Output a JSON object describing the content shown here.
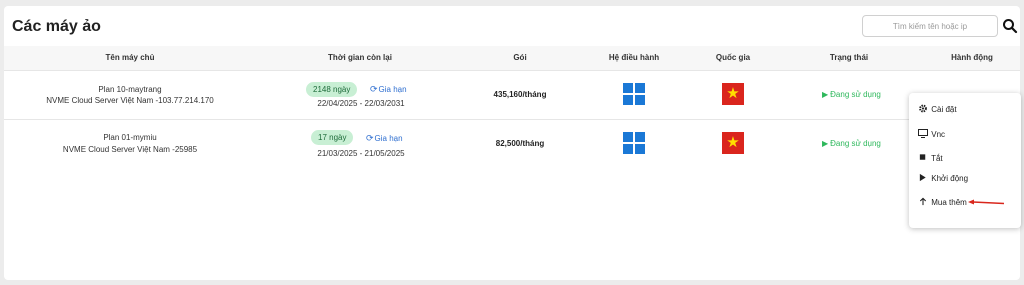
{
  "page": {
    "title": "Các máy ảo"
  },
  "search": {
    "placeholder": "Tìm kiếm tên hoặc ip",
    "icon": "search-icon"
  },
  "table": {
    "headers": [
      "Tên máy chủ",
      "Thời gian còn lại",
      "Gói",
      "Hệ điều hành",
      "Quốc gia",
      "Trạng thái",
      "Hành động"
    ],
    "rows": [
      {
        "name": "Plan 10-maytrang",
        "details": "NVME Cloud Server Việt Nam -103.77.214.170",
        "days_left": "2148 ngày",
        "renew_label": "Gia hạn",
        "date_range": "22/04/2025 - 22/03/2031",
        "price": "435,160/tháng",
        "os_icon": "windows-icon",
        "country_icon": "vietnam-flag-icon",
        "status": "Đang sử dụng"
      },
      {
        "name": "Plan 01-mymiu",
        "details": "NVME Cloud Server Việt Nam -25985",
        "days_left": "17 ngày",
        "renew_label": "Gia hạn",
        "date_range": "21/03/2025 - 21/05/2025",
        "price": "82,500/tháng",
        "os_icon": "windows-icon",
        "country_icon": "vietnam-flag-icon",
        "status": "Đang sử dụng"
      }
    ]
  },
  "action_menu": {
    "items": [
      {
        "label": "Cài đặt",
        "icon": "gear-icon"
      },
      {
        "label": "Vnc",
        "icon": "monitor-icon"
      },
      {
        "label": "Tắt",
        "icon": "stop-icon"
      },
      {
        "label": "Khởi động",
        "icon": "play-icon"
      },
      {
        "label": "Mua thêm",
        "icon": "arrow-up-icon"
      }
    ]
  },
  "colors": {
    "badge_bg": "#c8efd4",
    "badge_text": "#1d6b3a",
    "link": "#2f6fd0",
    "status_green": "#2eb85c",
    "windows_blue": "#1a78d6",
    "flag_red": "#da251d",
    "flag_star": "#ffde00",
    "annotation_arrow": "#d9261c"
  }
}
